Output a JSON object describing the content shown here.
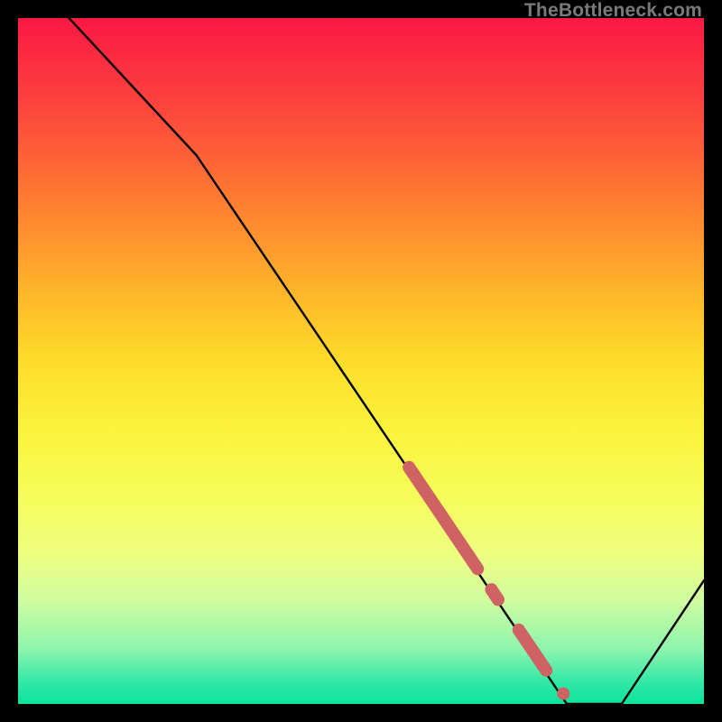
{
  "watermark": "TheBottleneck.com",
  "chart_data": {
    "type": "line",
    "title": "",
    "xlabel": "",
    "ylabel": "",
    "xlim": [
      0,
      100
    ],
    "ylim": [
      0,
      100
    ],
    "grid": false,
    "legend": false,
    "curve": [
      {
        "x": 0,
        "y": 108
      },
      {
        "x": 26,
        "y": 80
      },
      {
        "x": 80,
        "y": 0
      },
      {
        "x": 88,
        "y": 0
      },
      {
        "x": 100,
        "y": 18
      }
    ],
    "highlighted_segments": [
      {
        "x1": 57,
        "y1": 34.5,
        "x2": 67,
        "y2": 19.7
      },
      {
        "x1": 69,
        "y1": 16.7,
        "x2": 70,
        "y2": 15.2
      },
      {
        "x1": 73,
        "y1": 10.8,
        "x2": 77,
        "y2": 4.9
      }
    ],
    "highlighted_points": [
      {
        "x": 79.5,
        "y": 1.5
      }
    ],
    "color_scale_note": "vertical axis color: red (top) = worst, green (bottom) = best"
  }
}
